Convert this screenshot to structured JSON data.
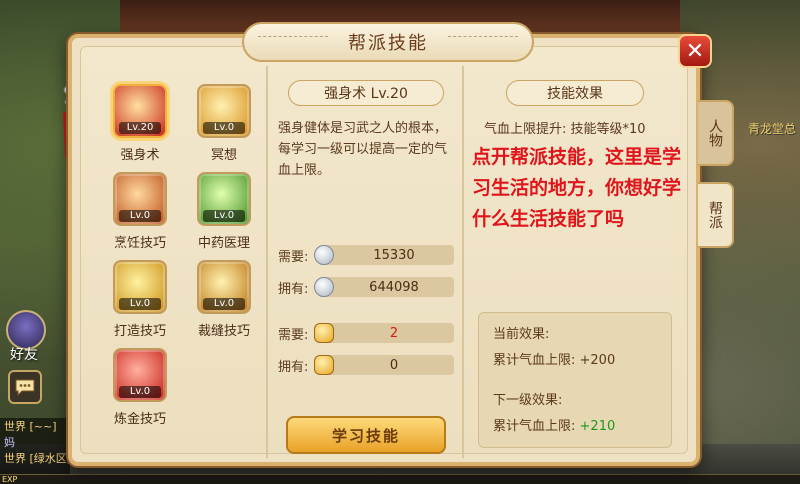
{
  "world": {
    "sign": "青龙堂总"
  },
  "hud": {
    "friends": "好友",
    "chat_lines": [
      "世界 [~~]",
      "妈",
      "世界 [绿水区] 白真盛 [华人"
    ],
    "exp": "EXP"
  },
  "panel": {
    "title": "帮派技能",
    "close": "✕",
    "side_tabs": [
      "人物",
      "帮派"
    ]
  },
  "skills": [
    {
      "name": "强身术",
      "level": "Lv.20",
      "colors": [
        "#ffe0a0",
        "#c8261a"
      ],
      "icon": "strength-icon",
      "selected": true
    },
    {
      "name": "冥想",
      "level": "Lv.0",
      "colors": [
        "#fff0b0",
        "#d48a14"
      ],
      "icon": "meditation-icon"
    },
    {
      "name": "烹饪技巧",
      "level": "Lv.0",
      "colors": [
        "#ffd8a0",
        "#b84a14"
      ],
      "icon": "cooking-icon"
    },
    {
      "name": "中药医理",
      "level": "Lv.0",
      "colors": [
        "#e0ffb0",
        "#3e8a1e"
      ],
      "icon": "herb-icon"
    },
    {
      "name": "打造技巧",
      "level": "Lv.0",
      "colors": [
        "#fff2a0",
        "#c88a10"
      ],
      "icon": "forging-icon"
    },
    {
      "name": "裁缝技巧",
      "level": "Lv.0",
      "colors": [
        "#fff2b0",
        "#b8700e"
      ],
      "icon": "tailoring-icon"
    },
    {
      "name": "炼金技巧",
      "level": "Lv.0",
      "colors": [
        "#ffb0a0",
        "#c41a12"
      ],
      "icon": "alchemy-icon"
    }
  ],
  "detail": {
    "title": "强身术 Lv.20",
    "description": "强身健体是习武之人的根本，每学习一级可以提高一定的气血上限。",
    "costs": [
      {
        "label": "需要:",
        "value": "15330",
        "coin": "silver-coin-icon",
        "red": false
      },
      {
        "label": "拥有:",
        "value": "644098",
        "coin": "silver-coin-icon",
        "red": false
      },
      {
        "label": "需要:",
        "value": "2",
        "coin": "gold-ingot-icon",
        "red": true
      },
      {
        "label": "拥有:",
        "value": "0",
        "coin": "gold-ingot-icon",
        "red": false
      }
    ],
    "learn_button": "学习技能"
  },
  "effect": {
    "title": "技能效果",
    "line": "气血上限提升: 技能等级*10",
    "note": "点开帮派技能，这里是学习生活的地方，你想好学什么生活技能了吗",
    "current_label": "当前效果:",
    "current_value_text": "累计气血上限: +200",
    "next_label": "下一级效果:",
    "next_value_prefix": "累计气血上限:",
    "next_value": "+210"
  }
}
